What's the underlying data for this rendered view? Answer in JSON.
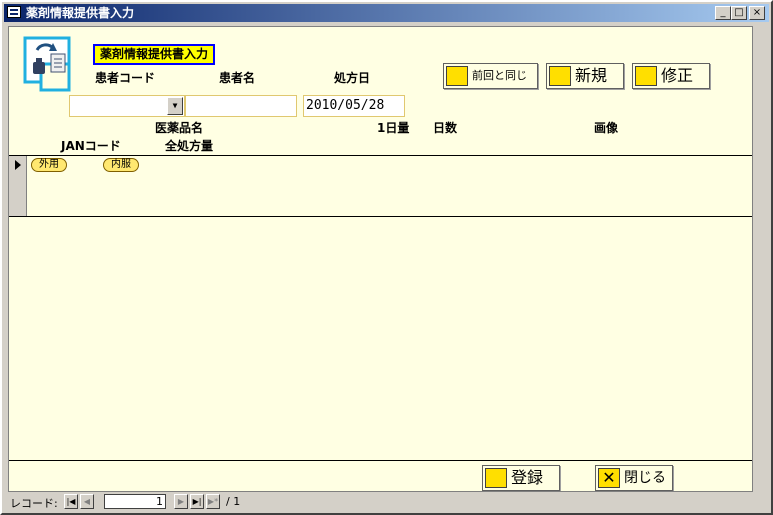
{
  "window": {
    "title": "薬剤情報提供書入力",
    "min_glyph": "_",
    "max_glyph": "□",
    "close_glyph": "×"
  },
  "form": {
    "title": "薬剤情報提供書入力",
    "labels": {
      "patient_code": "患者コード",
      "patient_name": "患者名",
      "rx_date": "処方日",
      "drug_name": "医薬品名",
      "daily_amount": "1日量",
      "days": "日数",
      "image": "画像",
      "jan_code": "JANコード",
      "total_amount": "全処方量"
    },
    "fields": {
      "patient_code": "",
      "patient_name": "",
      "rx_date": "2010/05/28"
    },
    "buttons": {
      "same_as_prev": "前回と同じ",
      "new": "新規",
      "edit": "修正",
      "register": "登録",
      "close": "閉じる"
    },
    "row_badges": {
      "external": "外用",
      "internal": "内服"
    }
  },
  "navigator": {
    "label": "レコード:",
    "current": "1",
    "total": "/ 1",
    "first_glyph": "|◀",
    "prev_glyph": "◀",
    "next_glyph": "▶",
    "last_glyph": "▶|",
    "new_glyph": "▶*"
  },
  "colors": {
    "form_bg": "#ffffe3",
    "accent_yellow": "#ffdf00",
    "title_border": "#0000ff",
    "titlebar": "#0a246a"
  }
}
